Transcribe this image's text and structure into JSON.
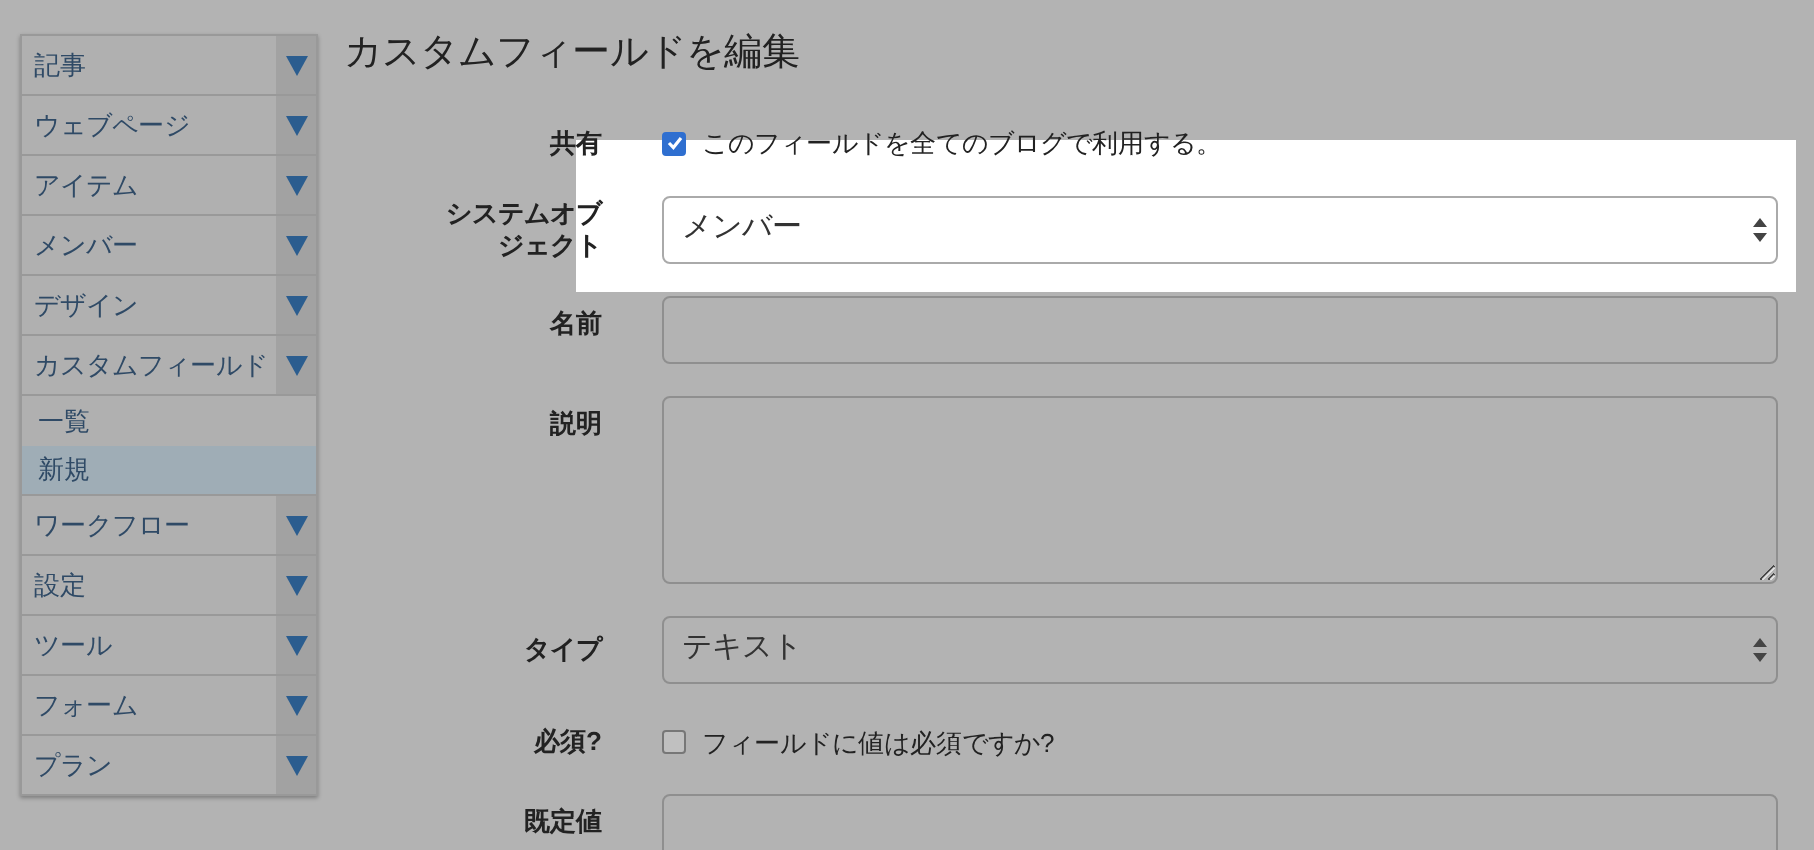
{
  "sidebar": {
    "items": [
      {
        "label": "記事"
      },
      {
        "label": "ウェブページ"
      },
      {
        "label": "アイテム"
      },
      {
        "label": "メンバー"
      },
      {
        "label": "デザイン"
      },
      {
        "label": "カスタムフィールド",
        "children": [
          {
            "label": "一覧",
            "selected": false
          },
          {
            "label": "新規",
            "selected": true
          }
        ]
      },
      {
        "label": "ワークフロー"
      },
      {
        "label": "設定"
      },
      {
        "label": "ツール"
      },
      {
        "label": "フォーム"
      },
      {
        "label": "プラン"
      }
    ]
  },
  "title": "カスタムフィールドを編集",
  "form": [
    {
      "kind": "checkbox",
      "label": "共有",
      "text": "このフィールドを全てのブログで利用する。",
      "checked": true,
      "highlighted": false
    },
    {
      "kind": "select",
      "label": "システムオブジェクト",
      "value": "メンバー",
      "highlighted": true
    },
    {
      "kind": "input",
      "label": "名前",
      "highlighted": false
    },
    {
      "kind": "textarea",
      "label": "説明",
      "highlighted": false
    },
    {
      "kind": "select",
      "label": "タイプ",
      "value": "テキスト",
      "highlighted": false
    },
    {
      "kind": "checkbox",
      "label": "必須?",
      "text": "フィールドに値は必須ですか?",
      "checked": false,
      "highlighted": false
    },
    {
      "kind": "input",
      "label": "既定値",
      "highlighted": false
    }
  ]
}
